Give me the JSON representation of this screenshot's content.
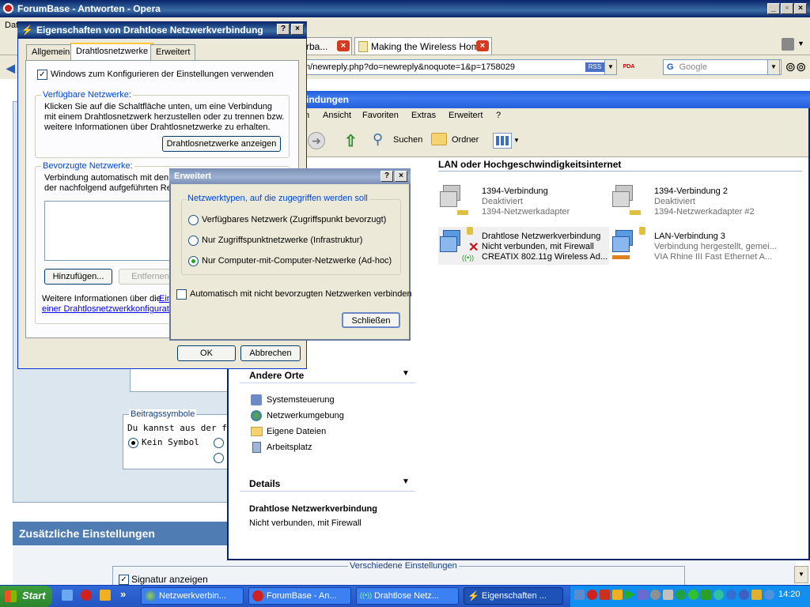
{
  "opera": {
    "title": "ForumBase - Antworten - Opera",
    "menu_first": "Dat",
    "tabs": [
      {
        "label": "rba..."
      },
      {
        "label": "Making the Wireless Hom..."
      }
    ],
    "address": "m/newreply.php?do=newreply&noquote=1&p=1758029",
    "rss_label": "RSS",
    "pda_label": "PDA",
    "search_placeholder": "Google",
    "page": {
      "beitrags_legend": "Beitragssymbole",
      "beitrags_text": "Du kannst aus der fol",
      "kein_symbol": "Kein Symbol",
      "zusatz_title": "Zusätzliche Einstellungen",
      "verschiedene_legend": "Verschiedene Einstellungen",
      "signatur_label": "Signatur anzeigen"
    }
  },
  "explorer": {
    "title": "indungen",
    "menu": [
      "n",
      "Ansicht",
      "Favoriten",
      "Extras",
      "Erweitert",
      "?"
    ],
    "toolbar": {
      "suchen": "Suchen",
      "ordner": "Ordner"
    },
    "section_header": "LAN oder Hochgeschwindigkeitsinternet",
    "connections": [
      {
        "name": "1394-Verbindung",
        "status": "Deaktiviert",
        "device": "1394-Netzwerkadapter"
      },
      {
        "name": "1394-Verbindung 2",
        "status": "Deaktiviert",
        "device": "1394-Netzwerkadapter #2"
      },
      {
        "name": "Drahtlose Netzwerkverbindung",
        "status": "Nicht verbunden, mit Firewall",
        "device": "CREATIX 802.11g Wireless Ad..."
      },
      {
        "name": "LAN-Verbindung 3",
        "status": "Verbindung hergestellt, gemei...",
        "device": "VIA Rhine III Fast Ethernet A..."
      }
    ],
    "andere_orte": {
      "title": "Andere Orte",
      "items": [
        "Systemsteuerung",
        "Netzwerkumgebung",
        "Eigene Dateien",
        "Arbeitsplatz"
      ]
    },
    "details": {
      "title": "Details",
      "name": "Drahtlose Netzwerkverbindung",
      "status": "Nicht verbunden, mit Firewall"
    }
  },
  "props_dialog": {
    "title": "Eigenschaften von Drahtlose Netzwerkverbindung",
    "tabs": [
      "Allgemein",
      "Drahtlosnetzwerke",
      "Erweitert"
    ],
    "windows_config_label": "Windows zum Konfigurieren der Einstellungen verwenden",
    "verfuegbar_legend": "Verfügbare Netzwerke:",
    "verfuegbar_text": "Klicken Sie auf die Schaltfläche unten, um eine Verbindung mit einem Drahtlosnetzwerk herzustellen oder zu trennen bzw. weitere Informationen über Drahtlosnetzwerke zu erhalten.",
    "anzeigen_button": "Drahtlosnetzwerke anzeigen",
    "bevorzugt_legend": "Bevorzugte Netzwerke:",
    "bevorzugt_text_1": "Verbindung automatisch mit den v",
    "bevorzugt_text_2": "der nachfolgend aufgeführten Re",
    "hinzufuegen_button": "Hinzufügen...",
    "entfernen_button": "Entfernen",
    "info_text": "Weitere Informationen über die",
    "info_link_1": "Ein",
    "info_link_2": "einer Drahtlosnetzwerkkonfigurati",
    "ok_button": "OK",
    "abbrechen_button": "Abbrechen"
  },
  "erweitert_dialog": {
    "title": "Erweitert",
    "group_legend": "Netzwerktypen, auf die zugegriffen werden soll",
    "options": [
      "Verfügbares Netzwerk (Zugriffspunkt bevorzugt)",
      "Nur Zugriffspunktnetzwerke (Infrastruktur)",
      "Nur Computer-mit-Computer-Netzwerke (Ad-hoc)"
    ],
    "selected_option": 3,
    "auto_connect_label": "Automatisch mit nicht bevorzugten Netzwerken verbinden",
    "close_button": "Schließen"
  },
  "taskbar": {
    "start_label": "Start",
    "chevron": "»",
    "tasks": [
      "Netzwerkverbin...",
      "ForumBase - An...",
      "Drahtlose Netz...",
      "Eigenschaften ..."
    ],
    "clock": "14:20"
  }
}
